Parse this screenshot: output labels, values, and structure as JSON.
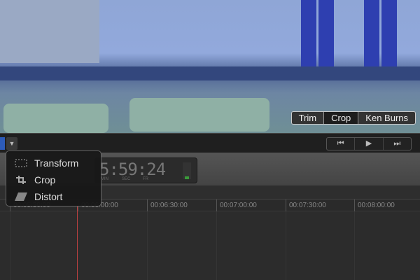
{
  "viewer": {
    "modes": [
      {
        "label": "Trim",
        "active": false
      },
      {
        "label": "Crop",
        "active": true
      },
      {
        "label": "Ken Burns",
        "active": false
      }
    ]
  },
  "toolbar": {
    "dropdown_icon": "triangle-down",
    "transport": {
      "prev": "⏮",
      "play": "▶",
      "next": "⏭"
    }
  },
  "timecode": {
    "value": "5:59:24",
    "labels": {
      "min": "MIN",
      "sec": "SEC",
      "fr": "FR"
    }
  },
  "menu": {
    "items": [
      {
        "label": "Transform",
        "icon": "transform-icon"
      },
      {
        "label": "Crop",
        "icon": "crop-icon"
      },
      {
        "label": "Distort",
        "icon": "distort-icon"
      }
    ]
  },
  "ruler": {
    "ticks": [
      "00:05:30:00",
      "00:06:00:00",
      "00:06:30:00",
      "00:07:00:00",
      "00:07:30:00",
      "00:08:00:00"
    ]
  },
  "colors": {
    "playhead": "#b84040",
    "accent": "#2d5bb8"
  }
}
